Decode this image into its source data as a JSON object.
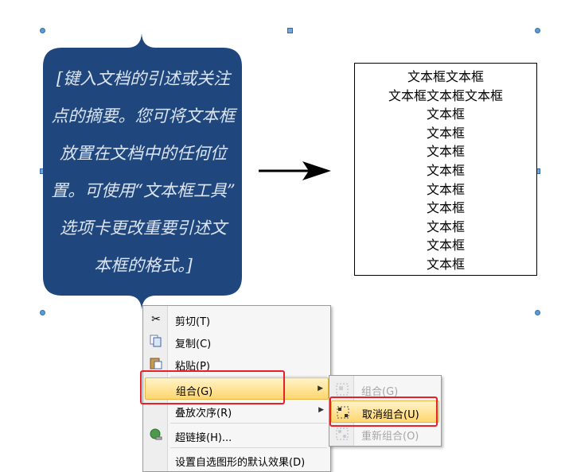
{
  "callout": {
    "text": "[键入文档的引述或关注\n点的摘要。您可将文本框\n放置在文档中的任何位\n置。可使用“文本框工具”\n选项卡更改重要引述文\n本框的格式。]",
    "fill_color": "#1f477e"
  },
  "arrow": {
    "icon": "right-arrow-icon"
  },
  "textbox": {
    "lines": [
      "文本框文本框",
      "文本框文本框文本框",
      "文本框",
      "文本框",
      "文本框",
      "文本框",
      "文本框",
      "文本框",
      "文本框",
      "文本框",
      "文本框"
    ]
  },
  "context_menu": {
    "items": [
      {
        "label": "剪切(T)",
        "icon": "scissors-icon"
      },
      {
        "label": "复制(C)",
        "icon": "copy-icon"
      },
      {
        "label": "粘贴(P)",
        "icon": "paste-icon"
      },
      {
        "label": "组合(G)",
        "icon": "",
        "submenu": true,
        "highlighted": true
      },
      {
        "label": "叠放次序(R)",
        "icon": "",
        "submenu": true
      },
      {
        "label": "超链接(H)...",
        "icon": "hyperlink-icon"
      },
      {
        "label": "设置自选图形的默认效果(D)",
        "icon": ""
      }
    ]
  },
  "submenu": {
    "items": [
      {
        "label": "组合(G)",
        "icon": "group-icon",
        "disabled": true
      },
      {
        "label": "取消组合(U)",
        "icon": "ungroup-icon",
        "highlighted": true
      },
      {
        "label": "重新组合(O)",
        "icon": "regroup-icon",
        "disabled": true
      }
    ]
  },
  "colors": {
    "highlight_box": "#e8202a",
    "menu_hover": "#ffd66e"
  }
}
